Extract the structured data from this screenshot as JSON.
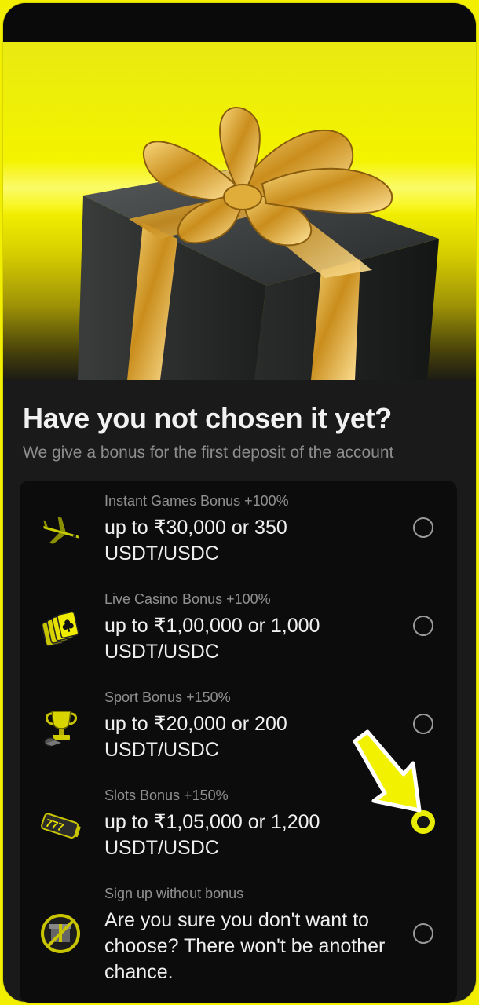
{
  "heading": "Have you not chosen it yet?",
  "subheading": "We give a bonus for the first deposit of the account",
  "options": [
    {
      "label": "Instant Games Bonus +100%",
      "amount": "up to ₹30,000 or 350 USDT/USDC",
      "icon": "airplane-icon",
      "selected": false
    },
    {
      "label": "Live Casino Bonus +100%",
      "amount": "up to ₹1,00,000 or 1,000 USDT/USDC",
      "icon": "playing-cards-icon",
      "selected": false
    },
    {
      "label": "Sport Bonus +150%",
      "amount": "up to ₹20,000 or 200 USDT/USDC",
      "icon": "trophy-icon",
      "selected": false
    },
    {
      "label": "Slots Bonus +150%",
      "amount": "up to ₹1,05,000 or 1,200 USDT/USDC",
      "icon": "slot-reel-icon",
      "selected": true
    },
    {
      "label": "Sign up without bonus",
      "amount": "Are you sure you don't want to choose? There won't be another chance.",
      "icon": "no-gift-icon",
      "selected": false
    }
  ],
  "colors": {
    "accent": "#e8ec00",
    "background": "#1a1a1a",
    "card": "#0c0c0c",
    "gift_ribbon": "#d9a52a"
  }
}
